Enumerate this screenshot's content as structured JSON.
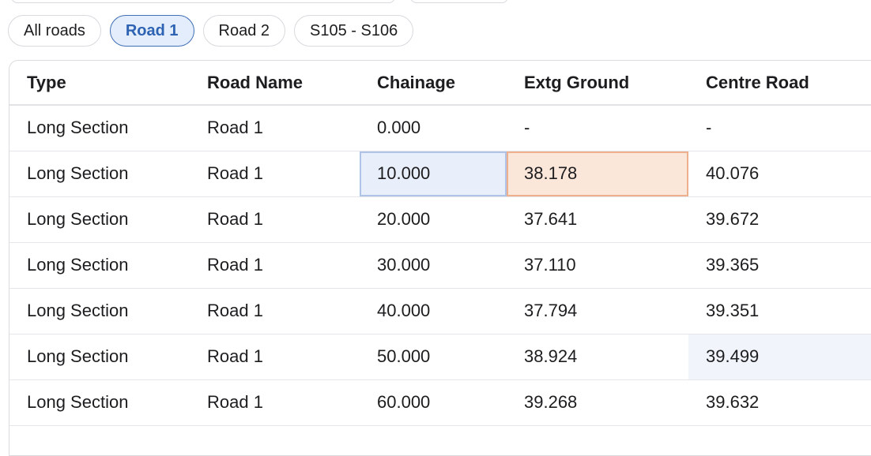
{
  "filters": {
    "chips": [
      {
        "label": "All roads",
        "active": false
      },
      {
        "label": "Road 1",
        "active": true
      },
      {
        "label": "Road 2",
        "active": false
      },
      {
        "label": "S105 - S106",
        "active": false
      }
    ]
  },
  "table": {
    "headers": {
      "type": "Type",
      "road_name": "Road Name",
      "chainage": "Chainage",
      "extg_ground": "Extg Ground",
      "centre_road": "Centre Road"
    },
    "rows": [
      {
        "type": "Long Section",
        "road_name": "Road 1",
        "chainage": "0.000",
        "extg_ground": "-",
        "centre_road": "-"
      },
      {
        "type": "Long Section",
        "road_name": "Road 1",
        "chainage": "10.000",
        "extg_ground": "38.178",
        "centre_road": "40.076"
      },
      {
        "type": "Long Section",
        "road_name": "Road 1",
        "chainage": "20.000",
        "extg_ground": "37.641",
        "centre_road": "39.672"
      },
      {
        "type": "Long Section",
        "road_name": "Road 1",
        "chainage": "30.000",
        "extg_ground": "37.110",
        "centre_road": "39.365"
      },
      {
        "type": "Long Section",
        "road_name": "Road 1",
        "chainage": "40.000",
        "extg_ground": "37.794",
        "centre_road": "39.351"
      },
      {
        "type": "Long Section",
        "road_name": "Road 1",
        "chainage": "50.000",
        "extg_ground": "38.924",
        "centre_road": "39.499"
      },
      {
        "type": "Long Section",
        "road_name": "Road 1",
        "chainage": "60.000",
        "extg_ground": "39.268",
        "centre_road": "39.632"
      },
      {
        "type": "",
        "road_name": "",
        "chainage": "",
        "extg_ground": "",
        "centre_road": ""
      }
    ]
  },
  "colors": {
    "accent": "#2e63b3",
    "selected_cell": "#e8eefa",
    "edited_cell": "#fbe6da"
  }
}
